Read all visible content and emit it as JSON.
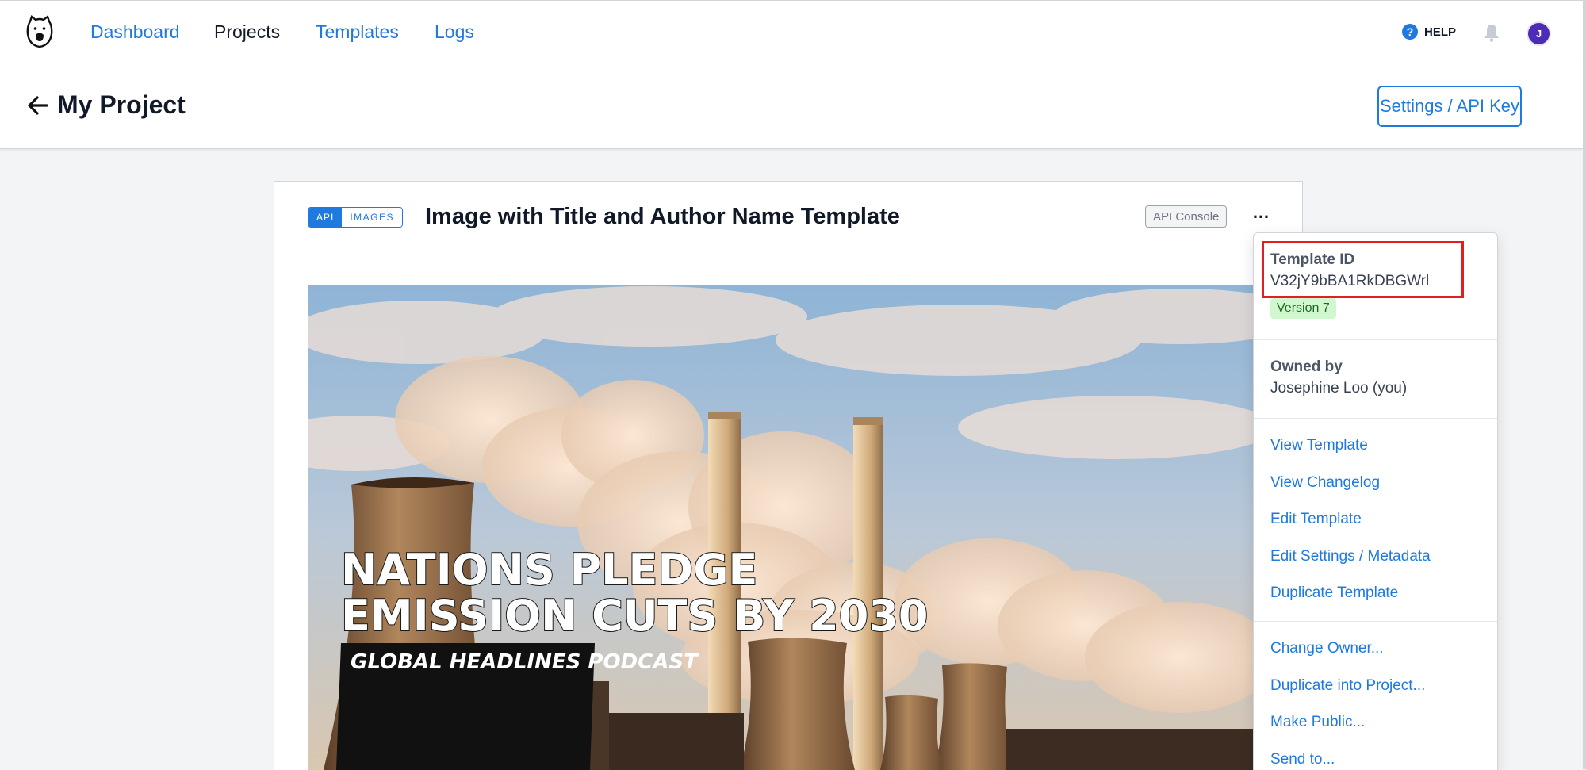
{
  "nav": {
    "items": [
      {
        "label": "Dashboard",
        "active": false
      },
      {
        "label": "Projects",
        "active": true
      },
      {
        "label": "Templates",
        "active": false
      },
      {
        "label": "Logs",
        "active": false
      }
    ],
    "help_label": "HELP",
    "help_icon": "?",
    "avatar_initial": "J"
  },
  "header": {
    "title": "My Project",
    "settings_button": "Settings / API Key"
  },
  "card": {
    "badge_api": "API",
    "badge_images": "IMAGES",
    "title": "Image with Title and Author Name Template",
    "api_console": "API Console",
    "more_icon": "…",
    "preview": {
      "headline_line1": "NATIONS PLEDGE",
      "headline_line2": "EMISSION CUTS BY 2030",
      "tagline": "GLOBAL HEADLINES PODCAST"
    }
  },
  "dropdown": {
    "template_id_label": "Template ID",
    "template_id_value": "V32jY9bBA1RkDBGWrl",
    "version": "Version 7",
    "owned_by_label": "Owned by",
    "owned_by_value": "Josephine Loo (you)",
    "links_group1": [
      "View Template",
      "View Changelog",
      "Edit Template",
      "Edit Settings / Metadata",
      "Duplicate Template"
    ],
    "links_group2": [
      "Change Owner...",
      "Duplicate into Project...",
      "Make Public...",
      "Send to..."
    ]
  },
  "colors": {
    "accent": "#1f7ae0",
    "highlight": "#e02020",
    "version_bg": "#d1f7cf",
    "avatar": "#4c2bb8"
  }
}
